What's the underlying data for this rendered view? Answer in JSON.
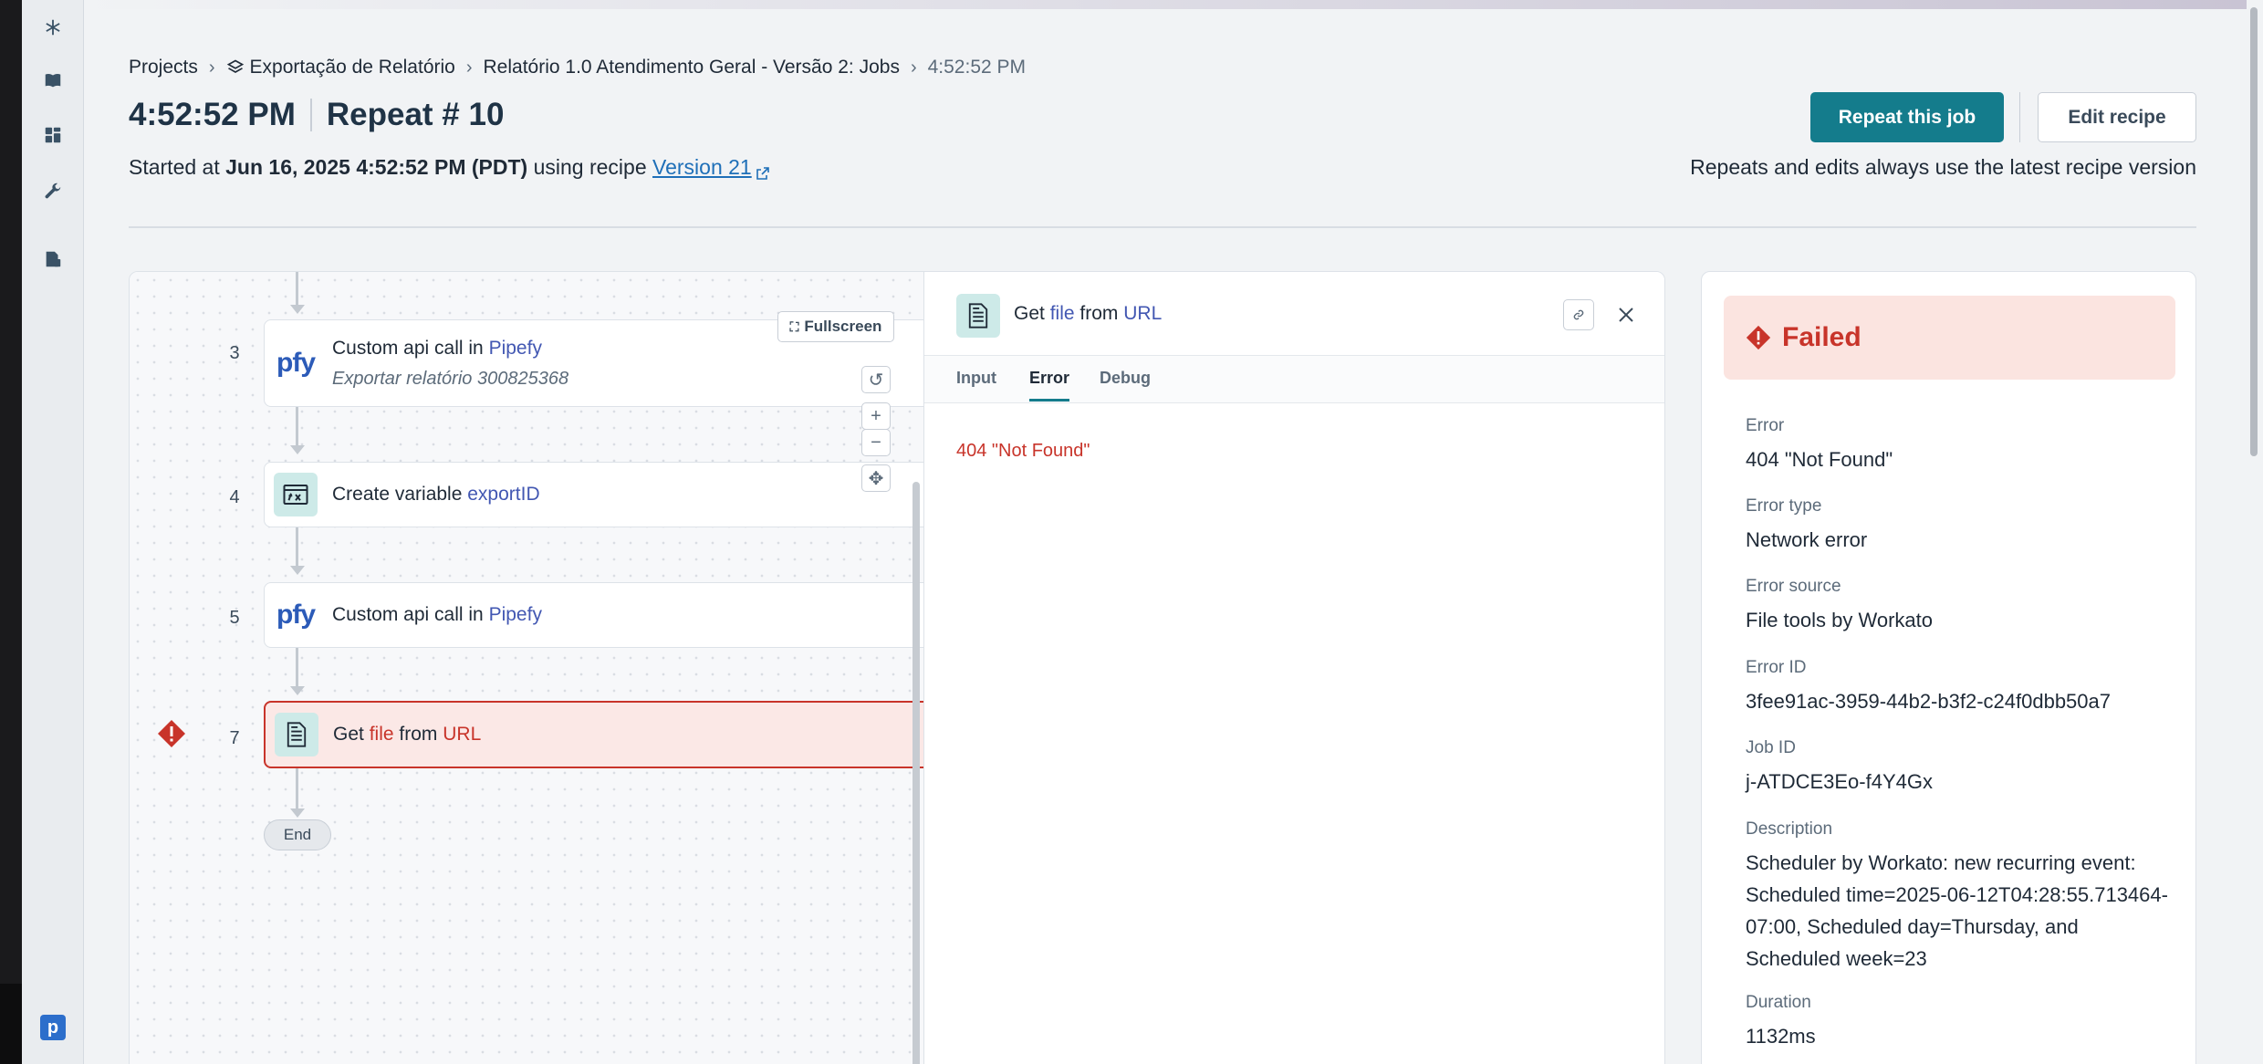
{
  "breadcrumb": {
    "projects": "Projects",
    "project": "Exportação de Relatório",
    "recipe": "Relatório 1.0 Atendimento Geral - Versão 2: Jobs",
    "current": "4:52:52 PM"
  },
  "header": {
    "time": "4:52:52 PM",
    "repeat": "Repeat # 10",
    "started_prefix": "Started at",
    "started_at": "Jun 16, 2025 4:52:52 PM (PDT)",
    "using_recipe": "using recipe",
    "version_link": "Version 21",
    "repeat_button": "Repeat this job",
    "edit_button": "Edit recipe",
    "repeats_note": "Repeats and edits always use the latest recipe version"
  },
  "canvas": {
    "fullscreen": "Fullscreen",
    "zoom_in": "+",
    "zoom_out": "−",
    "end": "End",
    "steps": [
      {
        "num": "3",
        "prefix": "Custom api call in",
        "kw": "Pipefy",
        "sub": "Exportar relatório 300825368"
      },
      {
        "num": "4",
        "prefix": "Create variable",
        "kw": "exportID"
      },
      {
        "num": "5",
        "prefix": "Custom api call in",
        "kw": "Pipefy"
      },
      {
        "num": "7",
        "prefix": "Get",
        "kw1": "file",
        "mid": "from",
        "kw2": "URL",
        "status": "error"
      }
    ]
  },
  "detail": {
    "title_prefix": "Get",
    "title_kw1": "file",
    "title_mid": "from",
    "title_kw2": "URL",
    "tabs": [
      "Input",
      "Error",
      "Debug"
    ],
    "active_tab": "Error",
    "error_message": "404 \"Not Found\""
  },
  "status_panel": {
    "state": "Failed",
    "fields": [
      {
        "label": "Error",
        "value": "404 \"Not Found\""
      },
      {
        "label": "Error type",
        "value": "Network error"
      },
      {
        "label": "Error source",
        "value": "File tools by Workato"
      },
      {
        "label": "Error ID",
        "value": "3fee91ac-3959-44b2-b3f2-c24f0dbb50a7"
      },
      {
        "label": "Job ID",
        "value": "j-ATDCE3Eo-f4Y4Gx"
      },
      {
        "label": "Description",
        "value": "Scheduler by Workato: new recurring event: Scheduled time=2025-06-12T04:28:55.713464-07:00, Scheduled day=Thursday, and Scheduled week=23"
      },
      {
        "label": "Duration",
        "value": "1132ms"
      }
    ]
  },
  "colors": {
    "primary": "#147c8c",
    "error": "#c8342a",
    "error_bg": "#fbe4e0",
    "link": "#1e6fb8",
    "keyword": "#4257b2"
  },
  "icons": [
    "snowflake-icon",
    "book-icon",
    "star-icon",
    "dashboard-icon",
    "clock-icon",
    "wrench-icon",
    "send-icon",
    "file-list-icon",
    "layers-icon",
    "external-link-icon",
    "link-icon",
    "close-icon",
    "alert-diamond-icon",
    "document-icon",
    "variable-icon",
    "pipefy-logo",
    "expand-icon",
    "reset-icon",
    "fit-icon"
  ]
}
